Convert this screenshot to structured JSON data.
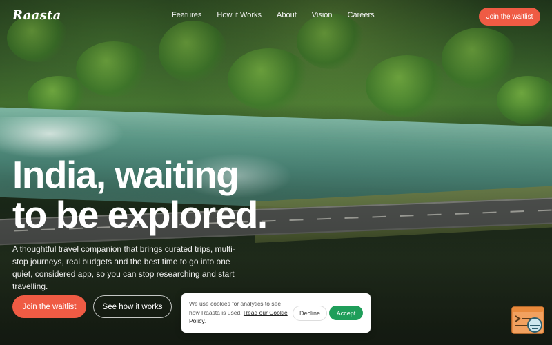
{
  "brand": {
    "logo": "Raasta"
  },
  "nav": {
    "links": [
      "Features",
      "How it Works",
      "About",
      "Vision",
      "Careers"
    ],
    "cta": "Join the waitlist"
  },
  "hero": {
    "headline_line1": "India, waiting",
    "headline_line2": "to be explored.",
    "subtext": "A thoughtful travel companion that brings curated trips, multi-stop journeys, real budgets and the best time to go into one quiet, considered app, so you can stop researching and start travelling.",
    "primary_cta": "Join the waitlist",
    "secondary_cta": "See how it works"
  },
  "cookie": {
    "text": "We use cookies for analytics to see how Raasta is used.",
    "link": "Read our Cookie Policy",
    "suffix": ".",
    "decline": "Decline",
    "accept": "Accept"
  },
  "widget": {
    "icon": "chat-widget-icon"
  },
  "colors": {
    "accent": "#ef5b44",
    "accept": "#1f9e5a"
  }
}
